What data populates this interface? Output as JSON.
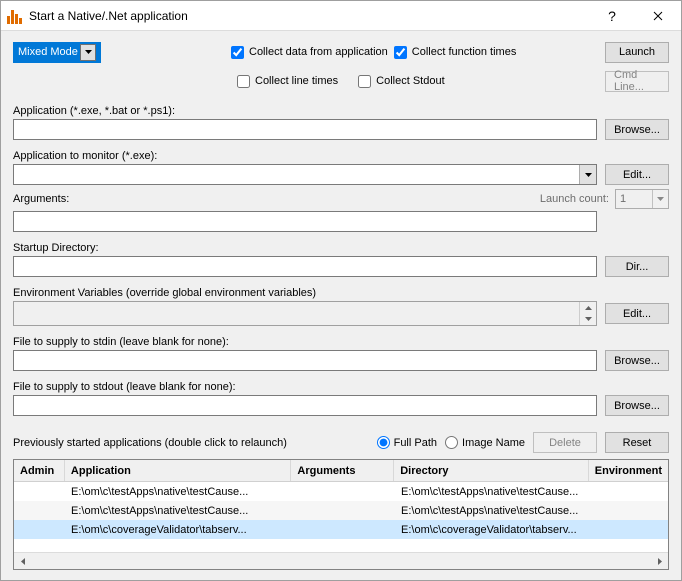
{
  "window": {
    "title": "Start a Native/.Net application"
  },
  "mode": {
    "selected": "Mixed Mode"
  },
  "checks": {
    "collect_app": "Collect data from application",
    "collect_func": "Collect function times",
    "collect_line": "Collect line times",
    "collect_stdout": "Collect Stdout"
  },
  "buttons": {
    "launch": "Launch",
    "cmdline": "Cmd Line...",
    "browse": "Browse...",
    "edit": "Edit...",
    "dir": "Dir...",
    "delete": "Delete",
    "reset": "Reset"
  },
  "labels": {
    "application": "Application (*.exe, *.bat or *.ps1):",
    "app_monitor": "Application to monitor (*.exe):",
    "arguments": "Arguments:",
    "launch_count": "Launch count:",
    "startup_dir": "Startup Directory:",
    "env_vars": "Environment Variables (override global environment variables)",
    "stdin": "File to supply to stdin (leave blank for none):",
    "stdout": "File to supply to stdout (leave blank for none):",
    "previously": "Previously started applications (double click to relaunch)",
    "full_path": "Full Path",
    "image_name": "Image Name"
  },
  "launch_count_value": "1",
  "table": {
    "headers": {
      "admin": "Admin",
      "app": "Application",
      "args": "Arguments",
      "dir": "Directory",
      "env": "Environment"
    },
    "rows": [
      {
        "admin": "",
        "app": "E:\\om\\c\\testApps\\native\\testCause...",
        "args": "",
        "dir": "E:\\om\\c\\testApps\\native\\testCause...",
        "env": ""
      },
      {
        "admin": "",
        "app": "E:\\om\\c\\testApps\\native\\testCause...",
        "args": "",
        "dir": "E:\\om\\c\\testApps\\native\\testCause...",
        "env": ""
      },
      {
        "admin": "",
        "app": "E:\\om\\c\\coverageValidator\\tabserv...",
        "args": "",
        "dir": "E:\\om\\c\\coverageValidator\\tabserv...",
        "env": ""
      }
    ]
  }
}
